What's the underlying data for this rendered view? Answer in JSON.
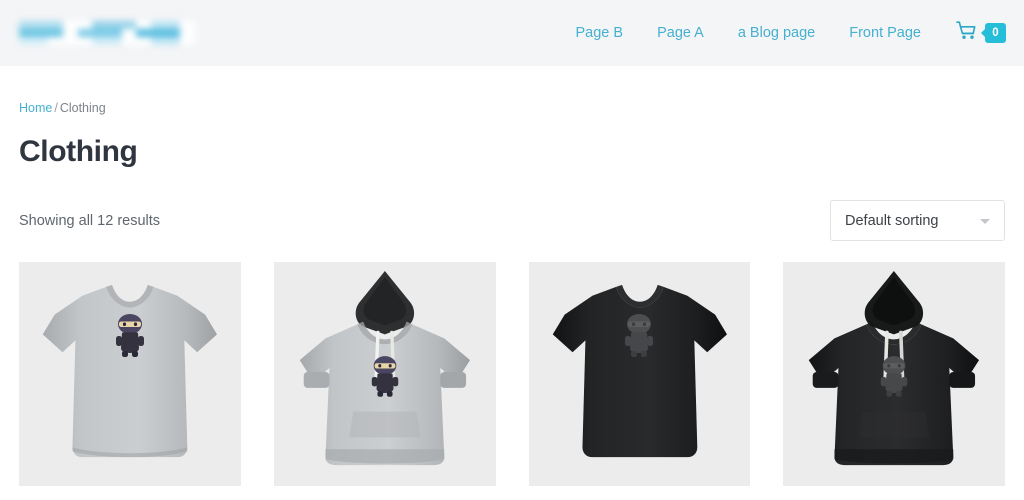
{
  "header": {
    "logo": {
      "name": "site-logo",
      "redacted": true,
      "color": "#7ecbe4"
    },
    "nav": [
      {
        "label": "Page B"
      },
      {
        "label": "Page A"
      },
      {
        "label": "a Blog page"
      },
      {
        "label": "Front Page"
      }
    ],
    "cart": {
      "icon": "shopping-cart-icon",
      "count": "0",
      "badge_color": "#25bdd8"
    },
    "background": "#f4f5f7"
  },
  "breadcrumb": {
    "home_label": "Home",
    "separator": "/",
    "current_label": "Clothing"
  },
  "page": {
    "title": "Clothing",
    "result_count_text": "Showing all 12 results"
  },
  "sorting": {
    "selected": "Default sorting",
    "chevron": "chevron-down-icon"
  },
  "products": [
    {
      "name": "gray-tshirt",
      "type": "tshirt",
      "garment_color": "#b8bbbd",
      "garment_shadow": "#a3a6a9",
      "graphic": "ninja-character",
      "graphic_style": "color"
    },
    {
      "name": "gray-hoodie",
      "type": "hoodie",
      "garment_color": "#bcbfc1",
      "garment_shadow": "#a6a9ac",
      "hood_color": "#2e2f31",
      "graphic": "ninja-character",
      "graphic_style": "color"
    },
    {
      "name": "black-tshirt",
      "type": "tshirt",
      "garment_color": "#1e1f21",
      "garment_shadow": "#121314",
      "graphic": "ninja-character",
      "graphic_style": "dark"
    },
    {
      "name": "black-hoodie",
      "type": "hoodie",
      "garment_color": "#232426",
      "garment_shadow": "#151617",
      "hood_color": "#141516",
      "graphic": "ninja-character",
      "graphic_style": "dark"
    }
  ],
  "theme": {
    "accent": "#45b0cf",
    "badge": "#25bdd8",
    "tile_bg": "#ececec",
    "title_color": "#2f3640"
  }
}
